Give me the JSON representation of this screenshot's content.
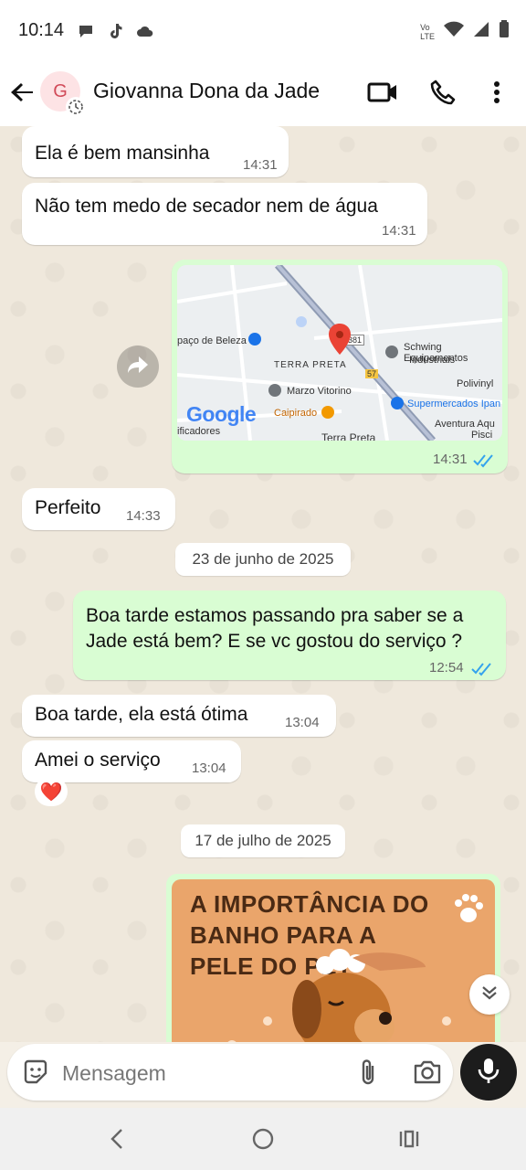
{
  "status_bar": {
    "time": "10:14",
    "net_label_top": "Vo",
    "net_label_bottom": "LTE"
  },
  "header": {
    "avatar_initial": "G",
    "contact_name": "Giovanna Dona da Jade"
  },
  "messages": [
    {
      "text": "Ela é bem mansinha",
      "time": "14:31",
      "direction": "in"
    },
    {
      "text": "Não tem medo de secador nem de água",
      "time": "14:31",
      "direction": "in"
    },
    {
      "type": "location",
      "time": "14:31",
      "direction": "out",
      "status": "read"
    },
    {
      "text": "Perfeito",
      "time": "14:33",
      "direction": "in"
    },
    {
      "text": "Boa tarde estamos  passando pra saber se a Jade está bem? E se vc gostou do serviço ?",
      "time": "12:54",
      "direction": "out",
      "status": "read"
    },
    {
      "text": "Boa tarde, ela está ótima",
      "time": "13:04",
      "direction": "in"
    },
    {
      "text": "Amei o serviço",
      "time": "13:04",
      "direction": "in",
      "reaction": "❤️"
    },
    {
      "type": "image",
      "direction": "out",
      "image_text": "A IMPORTÂNCIA DO BANHO PARA A PELE DO PET"
    }
  ],
  "date_chips": [
    "23 de junho de 2025",
    "17 de julho de 2025"
  ],
  "map": {
    "labels": [
      "paço de Beleza",
      "Schwing Equipamentos",
      "Industriais",
      "TERRA PRETA",
      "Polivinyl",
      "Marzo Vitorino",
      "Supermercados Ipan",
      "Caipirado",
      "Aventura Aqu",
      "Pisci",
      "ificadores",
      "Terra Preta",
      "57",
      "381"
    ],
    "logo": "Google"
  },
  "composer": {
    "placeholder": "Mensagem"
  },
  "colors": {
    "incoming": "#ffffff",
    "outgoing": "#d9fdd3",
    "tick_read": "#34a3ed",
    "mic_bg": "#1c1c1c"
  }
}
